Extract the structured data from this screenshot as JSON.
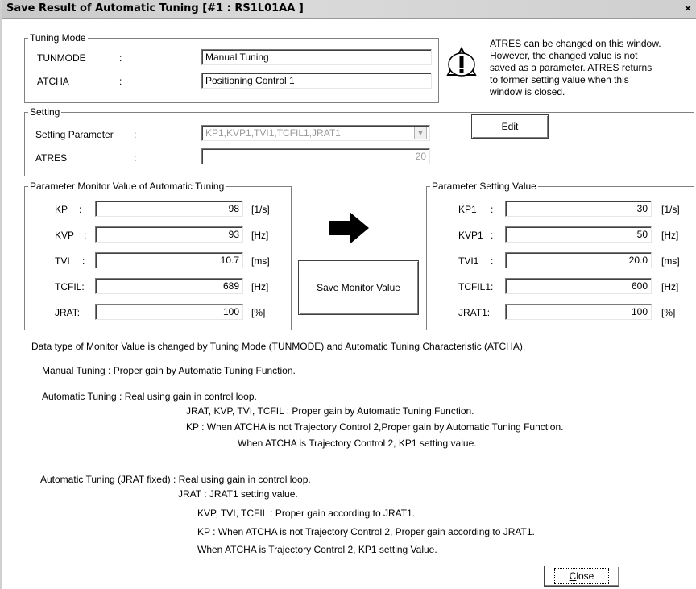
{
  "window": {
    "title": "Save Result of Automatic Tuning [#1 : RS1L01AA  ]",
    "close_glyph": "×"
  },
  "tuning_mode": {
    "legend": "Tuning Mode",
    "rows": [
      {
        "label": "TUNMODE",
        "colon": ":",
        "value": "Manual Tuning"
      },
      {
        "label": "ATCHA",
        "colon": ":",
        "value": "Positioning Control 1"
      }
    ]
  },
  "notice": {
    "icon": "warning-icon",
    "lines": [
      "ATRES can be changed on this window.",
      "However, the changed value is not",
      "saved as a parameter. ATRES returns",
      "to former setting value when this",
      "window is closed."
    ]
  },
  "setting": {
    "legend": "Setting",
    "param_label": "Setting Parameter",
    "param_colon": ":",
    "param_value": "KP1,KVP1,TVI1,TCFIL1,JRAT1",
    "atres_label": "ATRES",
    "atres_colon": ":",
    "atres_value": "20",
    "edit_button": "Edit"
  },
  "monitor": {
    "legend": "Parameter Monitor Value of Automatic Tuning",
    "rows": [
      {
        "label": "KP",
        "colon": ":",
        "value": "98",
        "unit": "[1/s]"
      },
      {
        "label": "KVP",
        "colon": ":",
        "value": "93",
        "unit": "[Hz]"
      },
      {
        "label": "TVI",
        "colon": ":",
        "value": "10.7",
        "unit": "[ms]"
      },
      {
        "label": "TCFIL:",
        "colon": "",
        "value": "689",
        "unit": "[Hz]"
      },
      {
        "label": "JRAT:",
        "colon": "",
        "value": "100",
        "unit": "[%]"
      }
    ]
  },
  "arrow_icon": "right-arrow-icon",
  "save_button": "Save Monitor Value",
  "setting_values": {
    "legend": "Parameter Setting Value",
    "rows": [
      {
        "label": "KP1",
        "colon": ":",
        "value": "30",
        "unit": "[1/s]"
      },
      {
        "label": "KVP1",
        "colon": ":",
        "value": "50",
        "unit": "[Hz]"
      },
      {
        "label": "TVI1",
        "colon": ":",
        "value": "20.0",
        "unit": "[ms]"
      },
      {
        "label": "TCFIL1:",
        "colon": "",
        "value": "600",
        "unit": "[Hz]"
      },
      {
        "label": "JRAT1:",
        "colon": "",
        "value": "100",
        "unit": "[%]"
      }
    ]
  },
  "info": {
    "lines": [
      "Data type of Monitor Value is changed by Tuning Mode (TUNMODE) and Automatic Tuning Characteristic (ATCHA).",
      "Manual Tuning : Proper gain by Automatic Tuning Function.",
      "Automatic Tuning : Real using gain in control loop.",
      "JRAT, KVP, TVI, TCFIL : Proper gain by Automatic Tuning Function.",
      "KP : When ATCHA is not Trajectory Control 2,Proper gain by Automatic Tuning Function.",
      "When ATCHA is Trajectory Control 2, KP1 setting value.",
      "Automatic Tuning (JRAT fixed) : Real using gain in control loop.",
      "JRAT : JRAT1 setting value.",
      "KVP, TVI, TCFIL : Proper gain according to JRAT1.",
      "KP : When ATCHA is not Trajectory Control 2, Proper gain according to JRAT1.",
      "When ATCHA is Trajectory Control 2, KP1 setting Value."
    ]
  },
  "close_button": {
    "prefix": "",
    "mnemonic": "C",
    "rest": "lose"
  }
}
